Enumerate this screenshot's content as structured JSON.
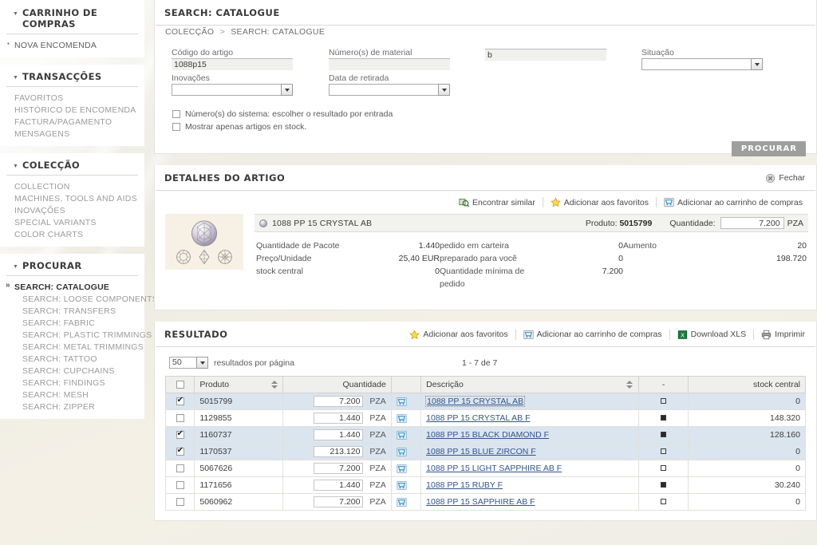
{
  "sidebar": {
    "panels": [
      {
        "title": "CARRINHO DE COMPRAS",
        "items": [
          {
            "label": "NOVA ENCOMENDA",
            "style": "bullet"
          }
        ]
      },
      {
        "title": "TRANSACÇÕES",
        "items": [
          {
            "label": "FAVORITOS",
            "style": "plain"
          },
          {
            "label": "HISTÓRICO DE ENCOMENDA",
            "style": "plain"
          },
          {
            "label": "FACTURA/PAGAMENTO",
            "style": "plain"
          },
          {
            "label": "MENSAGENS",
            "style": "plain"
          }
        ]
      },
      {
        "title": "COLECÇÃO",
        "items": [
          {
            "label": "COLLECTION",
            "style": "plain"
          },
          {
            "label": "MACHINES, TOOLS AND AIDS",
            "style": "plain"
          },
          {
            "label": "INOVAÇÕES",
            "style": "plain"
          },
          {
            "label": "SPECIAL VARIANTS",
            "style": "plain"
          },
          {
            "label": "COLOR CHARTS",
            "style": "plain"
          }
        ]
      },
      {
        "title": "PROCURAR",
        "items": [
          {
            "label": "SEARCH: CATALOGUE",
            "style": "active"
          },
          {
            "label": "SEARCH: LOOSE COMPONENTS",
            "style": "sub"
          },
          {
            "label": "SEARCH: TRANSFERS",
            "style": "sub"
          },
          {
            "label": "SEARCH: FABRIC",
            "style": "sub"
          },
          {
            "label": "SEARCH: PLASTIC TRIMMINGS",
            "style": "sub"
          },
          {
            "label": "SEARCH: METAL TRIMMINGS",
            "style": "sub"
          },
          {
            "label": "SEARCH: TATTOO",
            "style": "sub"
          },
          {
            "label": "SEARCH: CUPCHAINS",
            "style": "sub"
          },
          {
            "label": "SEARCH: FINDINGS",
            "style": "sub"
          },
          {
            "label": "SEARCH: MESH",
            "style": "sub"
          },
          {
            "label": "SEARCH: ZIPPER",
            "style": "sub"
          }
        ]
      }
    ]
  },
  "search_panel": {
    "title": "SEARCH: CATALOGUE",
    "breadcrumb": {
      "root": "COLECÇÃO",
      "sep": ">",
      "current": "SEARCH: CATALOGUE"
    },
    "fields": {
      "article_code": {
        "label": "Código do artigo",
        "value": "1088p15",
        "placeholder": ""
      },
      "material_numbers": {
        "label": "Número(s) de material",
        "value": "",
        "placeholder": ""
      },
      "unlabeled": {
        "label": "",
        "value": "b",
        "placeholder": ""
      },
      "situation": {
        "label": "Situação",
        "value": ""
      },
      "innovations": {
        "label": "Inovações",
        "value": ""
      },
      "withdrawal_date": {
        "label": "Data de retirada",
        "value": ""
      }
    },
    "checkboxes": [
      {
        "label": "Número(s) do sistema: escolher o resultado por entrada",
        "checked": false
      },
      {
        "label": "Mostrar apenas artigos en stock.",
        "checked": false
      }
    ],
    "submit_label": "PROCURAR"
  },
  "details_panel": {
    "title": "DETALHES DO ARTIGO",
    "close_label": "Fechar",
    "tools": [
      {
        "label": "Encontrar similar",
        "icon": "find-similar-icon"
      },
      {
        "label": "Adicionar aos favoritos",
        "icon": "star-icon"
      },
      {
        "label": "Adicionar ao carrinho de compras",
        "icon": "cart-icon"
      }
    ],
    "item": {
      "name": "1088 PP 15 CRYSTAL AB",
      "product_label": "Produto:",
      "product_id": "5015799",
      "quantity_label": "Quantidade:",
      "quantity_value": "7.200",
      "quantity_unit": "PZA"
    },
    "specs": {
      "col1": {
        "labels": [
          "Quantidade de Pacote",
          "Preço/Unidade",
          "stock central"
        ],
        "values": [
          "1.440",
          "25,40 EUR",
          "0"
        ]
      },
      "col2": {
        "labels": [
          "pedido em carteira",
          "preparado para você",
          "Quantidade mínima de",
          "pedido"
        ],
        "values": [
          "0",
          "0",
          "7.200",
          ""
        ]
      },
      "col3": {
        "labels": [
          "Aumento",
          "",
          ""
        ],
        "values": [
          "20",
          "198.720",
          ""
        ]
      }
    }
  },
  "result_panel": {
    "title": "RESULTADO",
    "tools": [
      {
        "label": "Adicionar aos favoritos",
        "icon": "star-icon"
      },
      {
        "label": "Adicionar ao carrinho de compras",
        "icon": "cart-icon"
      },
      {
        "label": "Download XLS",
        "icon": "xls-icon"
      },
      {
        "label": "Imprimir",
        "icon": "printer-icon"
      }
    ],
    "per_page_value": "50",
    "per_page_label": "resultados por página",
    "count_text": "1 - 7  de 7",
    "columns": {
      "select": "",
      "product": "Produto",
      "quantity": "Quantidade",
      "cart": "",
      "description": "Descrição",
      "dash": "-",
      "stock": "stock central"
    },
    "rows": [
      {
        "checked": true,
        "product": "5015799",
        "qty": "7.200",
        "unit": "PZA",
        "desc": "1088 PP 15 CRYSTAL AB",
        "highlighted": true,
        "mark": "open",
        "stock": "0"
      },
      {
        "checked": false,
        "product": "1129855",
        "qty": "1.440",
        "unit": "PZA",
        "desc": "1088 PP 15 CRYSTAL AB F",
        "highlighted": false,
        "mark": "filled",
        "stock": "148.320"
      },
      {
        "checked": true,
        "product": "1160737",
        "qty": "1.440",
        "unit": "PZA",
        "desc": "1088 PP 15 BLACK DIAMOND F",
        "highlighted": true,
        "mark": "filled",
        "stock": "128.160"
      },
      {
        "checked": true,
        "product": "1170537",
        "qty": "213.120",
        "unit": "PZA",
        "desc": "1088 PP 15 BLUE ZIRCON F",
        "highlighted": true,
        "mark": "open",
        "stock": "0"
      },
      {
        "checked": false,
        "product": "5067626",
        "qty": "7.200",
        "unit": "PZA",
        "desc": "1088 PP 15 LIGHT SAPPHIRE AB F",
        "highlighted": false,
        "mark": "open",
        "stock": "0"
      },
      {
        "checked": false,
        "product": "1171656",
        "qty": "1.440",
        "unit": "PZA",
        "desc": "1088 PP 15 RUBY F",
        "highlighted": false,
        "mark": "filled",
        "stock": "30.240"
      },
      {
        "checked": false,
        "product": "5060962",
        "qty": "7.200",
        "unit": "PZA",
        "desc": "1088 PP 15 SAPPHIRE AB F",
        "highlighted": false,
        "mark": "open",
        "stock": "0"
      }
    ]
  },
  "colors": {
    "accent_blue": "#33548c",
    "row_highlight": "#dbe5ef",
    "button_grey": "#9e9e9e",
    "page_bg": "#f1efe7"
  }
}
